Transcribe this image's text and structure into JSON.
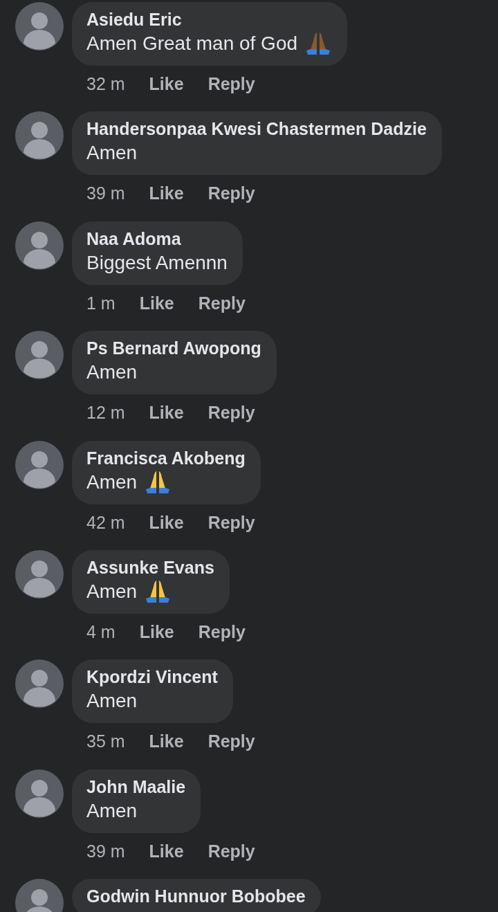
{
  "comments": [
    {
      "name": "Asiedu Eric",
      "text": "Amen Great man of God",
      "color": "#8b5a2b",
      "time": "32 m",
      "like": "Like",
      "reply": "Reply"
    },
    {
      "name": "Handersonpaa Kwesi Chastermen Dadzie",
      "text": "Amen",
      "time": "39 m",
      "like": "Like",
      "reply": "Reply"
    },
    {
      "name": "Naa Adoma",
      "text": "Biggest Amennn",
      "time": "1 m",
      "like": "Like",
      "reply": "Reply"
    },
    {
      "name": "Ps Bernard Awopong",
      "text": "Amen",
      "time": "12 m",
      "like": "Like",
      "reply": "Reply"
    },
    {
      "name": "Francisca Akobeng",
      "text": "Amen",
      "color": "#f5c542",
      "time": "42 m",
      "like": "Like",
      "reply": "Reply"
    },
    {
      "name": "Assunke Evans",
      "text": "Amen",
      "color": "#f5c542",
      "time": "4 m",
      "like": "Like",
      "reply": "Reply"
    },
    {
      "name": "Kpordzi Vincent",
      "text": "Amen",
      "time": "35 m",
      "like": "Like",
      "reply": "Reply"
    },
    {
      "name": "John Maalie",
      "text": "Amen",
      "time": "39 m",
      "like": "Like",
      "reply": "Reply"
    },
    {
      "name": "Godwin Hunnuor Bobobee"
    }
  ]
}
